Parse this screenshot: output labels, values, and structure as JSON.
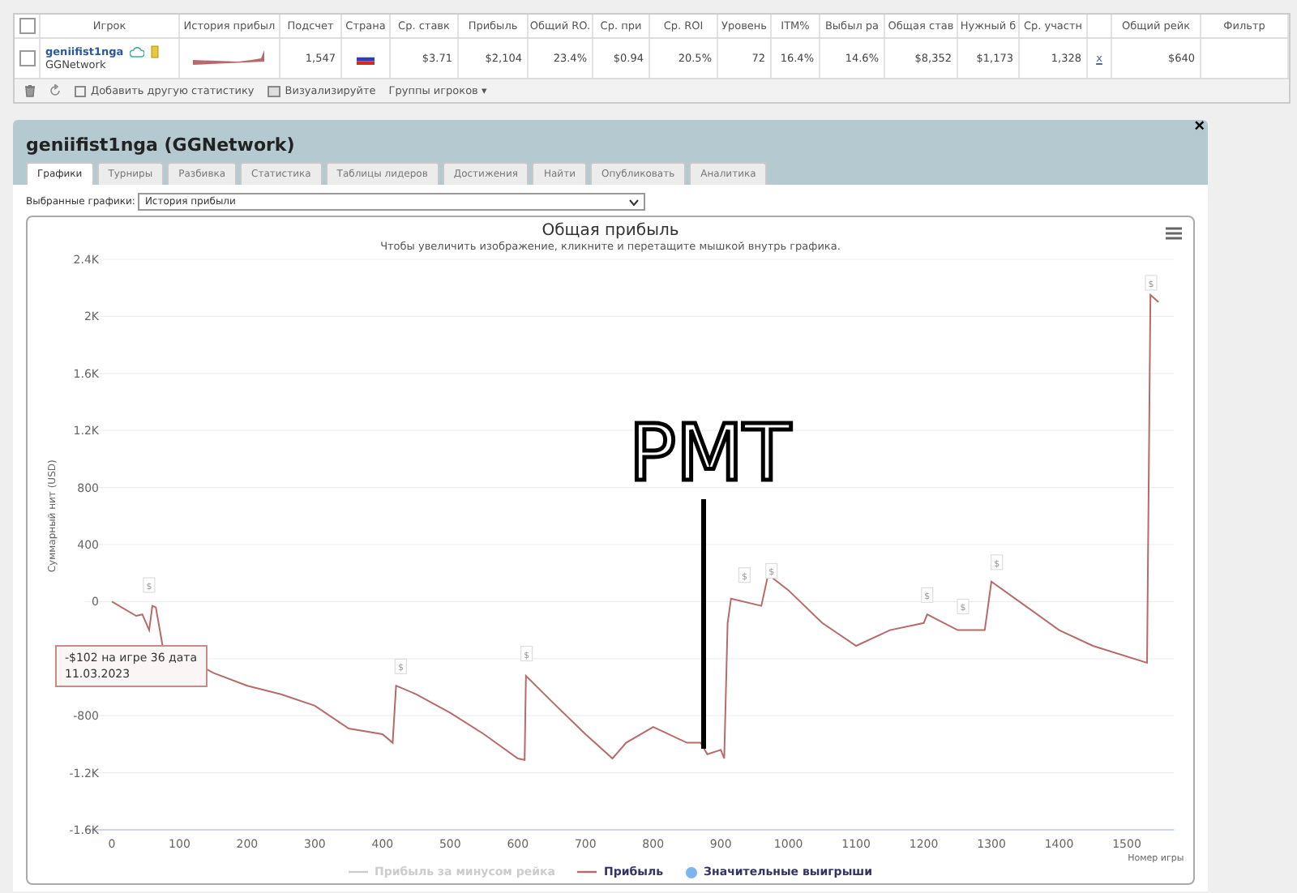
{
  "stats_table": {
    "select_all_checked": false,
    "columns": [
      "Игрок",
      "История прибыл",
      "Подсчет",
      "Страна",
      "Ср. ставк",
      "Прибыль",
      "Общий RO.",
      "Ср. при",
      "Ср. ROI",
      "Уровень",
      "ITM%",
      "Выбыл ра",
      "Общая став",
      "Нужный б",
      "Ср. участн",
      "",
      "Общий рейк",
      "Фильтр"
    ],
    "row": {
      "selected": false,
      "player": "geniifist1nga",
      "network": "GGNetwork",
      "count": "1,547",
      "avg_stake": "$3.71",
      "profit": "$2,104",
      "total_roi": "23.4%",
      "avg_profit": "$0.94",
      "avg_roi": "20.5%",
      "level": "72",
      "itm": "16.4%",
      "early_out": "14.6%",
      "total_stake": "$8,352",
      "needed": "$1,173",
      "avg_entrants": "1,328",
      "link": "x",
      "total_rake": "$640"
    },
    "toolbar": [
      "Добавить другую статистику",
      "Визуализируйте",
      "Группы игроков ▾"
    ]
  },
  "dialog": {
    "title": "geniifist1nga (GGNetwork)",
    "close": "×",
    "tabs": [
      {
        "label": "Графики",
        "selected": true
      },
      {
        "label": "Турниры",
        "selected": false
      },
      {
        "label": "Разбивка",
        "selected": false
      },
      {
        "label": "Статистика",
        "selected": false
      },
      {
        "label": "Таблицы лидеров",
        "selected": false
      },
      {
        "label": "Достижения",
        "selected": false
      },
      {
        "label": "Найти",
        "selected": false
      },
      {
        "label": "Опубликовать",
        "selected": false
      },
      {
        "label": "Аналитика",
        "selected": false
      }
    ],
    "select_label": "Выбранные графики:",
    "select_value": "История прибыли",
    "chart": {
      "subtitle": "Чтобы увеличить изображение, кликните и перетащите мышкой внутрь графика.",
      "tooltip": [
        "-$102 на игре 36 дата",
        "11.03.2023"
      ],
      "annotation": "PMT",
      "legend": [
        {
          "label": "Прибыль за минусом рейка",
          "kind": "line",
          "visible": false,
          "color": "#cccccc"
        },
        {
          "kind": "series",
          "visible": true
        },
        {
          "label": "Значительные выигрыши",
          "kind": "dot",
          "visible": true,
          "color": "#7cb5ec"
        }
      ],
      "chart_data": {
        "type": "line",
        "title": "Общая прибыль",
        "xlabel": "Номер игры",
        "ylabel": "Суммарный нит (USD)",
        "grid": true,
        "xlim": [
          -40,
          1570
        ],
        "ylim": [
          -1600,
          2400
        ],
        "xticks": [
          0,
          100,
          200,
          300,
          400,
          500,
          600,
          700,
          800,
          900,
          1000,
          1100,
          1200,
          1300,
          1400,
          1500
        ],
        "yticks": [
          {
            "value": -1600,
            "label": "-1.6K"
          },
          {
            "value": -1200,
            "label": "-1.2K"
          },
          {
            "value": -800,
            "label": "-800"
          },
          {
            "value": 0,
            "label": "0"
          },
          {
            "value": 400,
            "label": "400"
          },
          {
            "value": 800,
            "label": "800"
          },
          {
            "value": 1200,
            "label": "1.2K"
          },
          {
            "value": 1600,
            "label": "1.6K"
          },
          {
            "value": 2000,
            "label": "2K"
          },
          {
            "value": 2400,
            "label": "2.4K"
          }
        ],
        "x": [
          0,
          36,
          45,
          55,
          60,
          65,
          75,
          150,
          200,
          250,
          300,
          350,
          400,
          415,
          420,
          450,
          500,
          550,
          600,
          610,
          612,
          650,
          700,
          740,
          760,
          800,
          850,
          870,
          880,
          900,
          905,
          910,
          915,
          960,
          970,
          1000,
          1050,
          1100,
          1150,
          1200,
          1205,
          1250,
          1290,
          1300,
          1350,
          1400,
          1450,
          1530,
          1535,
          1547
        ],
        "series": [
          {
            "name": "Прибыль",
            "color": "#b86a6a",
            "values": [
              0,
              -100,
              -90,
              -200,
              -30,
              -40,
              -310,
              -500,
              -590,
              -650,
              -730,
              -890,
              -930,
              -990,
              -590,
              -650,
              -780,
              -930,
              -1100,
              -1110,
              -520,
              -700,
              -930,
              -1100,
              -990,
              -880,
              -990,
              -990,
              -1070,
              -1040,
              -1100,
              -150,
              20,
              -30,
              190,
              80,
              -150,
              -310,
              -200,
              -150,
              -90,
              -200,
              -200,
              140,
              -30,
              -200,
              -310,
              -430,
              2150,
              2100
            ]
          }
        ],
        "annotations": [
          {
            "x": 55,
            "y": 110,
            "text": "$"
          },
          {
            "x": 427,
            "y": -460,
            "text": "$"
          },
          {
            "x": 613,
            "y": -370,
            "text": "$"
          },
          {
            "x": 935,
            "y": 180,
            "text": "$"
          },
          {
            "x": 975,
            "y": 210,
            "text": "$"
          },
          {
            "x": 1205,
            "y": 40,
            "text": "$"
          },
          {
            "x": 1258,
            "y": -40,
            "text": "$"
          },
          {
            "x": 1308,
            "y": 270,
            "text": "$"
          },
          {
            "x": 1536,
            "y": 2230,
            "text": "$"
          }
        ]
      }
    }
  }
}
